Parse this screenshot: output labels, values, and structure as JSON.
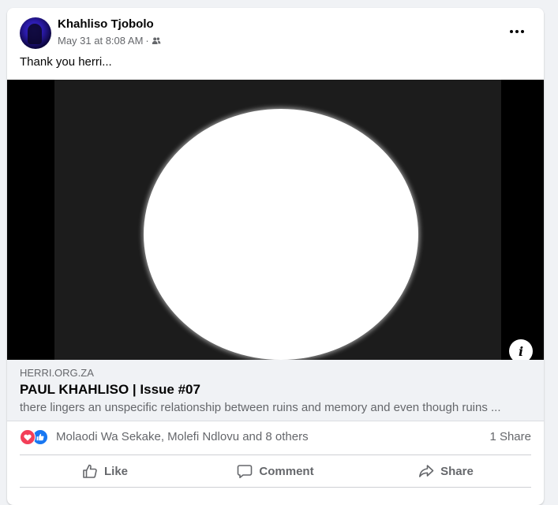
{
  "post": {
    "author": "Khahliso Tjobolo",
    "timestamp": "May 31 at 8:08 AM",
    "separator": "·",
    "audience_icon": "friends-icon",
    "caption": "Thank you herri..."
  },
  "link": {
    "domain": "HERRI.ORG.ZA",
    "title": "PAUL KHAHLISO | Issue #07",
    "description": "there lingers an unspecific relationship between ruins and memory and even though ruins ...",
    "info_label": "i"
  },
  "reactions": {
    "icons": [
      "love-icon",
      "like-icon"
    ],
    "names": "Molaodi Wa Sekake, Molefi Ndlovu and 8 others",
    "share_count": "1 Share"
  },
  "actions": {
    "like": "Like",
    "comment": "Comment",
    "share": "Share"
  },
  "colors": {
    "love": "#f33e58",
    "like": "#1877f2",
    "secondary_text": "#65676b",
    "preview_bg": "#f0f2f5"
  }
}
